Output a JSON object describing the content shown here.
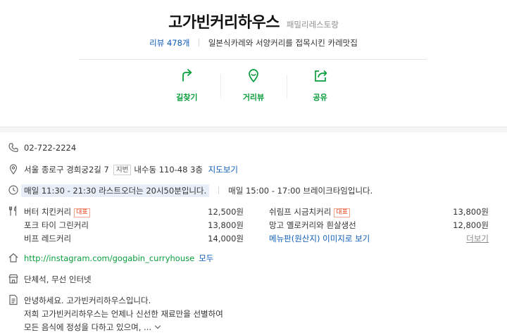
{
  "place": {
    "name": "고가빈커리하우스",
    "category": "패밀리레스토랑",
    "review_label": "리뷰 478개",
    "description": "일본식카레와 서양커리를 접목시킨 카레맛집"
  },
  "actions": [
    {
      "label": "길찾기",
      "icon": "directions-icon"
    },
    {
      "label": "거리뷰",
      "icon": "street-view-icon"
    },
    {
      "label": "공유",
      "icon": "share-icon"
    }
  ],
  "info": {
    "phone": "02-722-2224",
    "address": "서울 종로구 경희궁2길 7",
    "jibun_badge": "지번",
    "jibun_address": "내수동 110-48 3층",
    "map_link": "지도보기",
    "hours_1": "매일 11:30 - 21:30   라스트오더는 20시50분입니다.",
    "hours_2": "매일 15:00 - 17:00   브레이크타임입니다.",
    "menu": [
      {
        "name": "버터 치킨커리",
        "badge": "대표",
        "price": "12,500원"
      },
      {
        "name": "쉬림프 시금치커리",
        "badge": "대표",
        "price": "13,800원"
      },
      {
        "name": "포크 타이 그린커리",
        "badge": "",
        "price": "13,800원"
      },
      {
        "name": "망고 옐로커리와 흰살생선",
        "badge": "",
        "price": "12,800원"
      },
      {
        "name": "비프 레드커리",
        "badge": "",
        "price": "14,000원"
      }
    ],
    "menu_photo_link": "메뉴판(원산지) 이미지로 보기",
    "menu_more": "더보기",
    "homepage_url": "http://instagram.com/gogabin_curryhouse",
    "homepage_all": "모두",
    "amenities": "단체석, 무선 인터넷",
    "intro": [
      "안녕하세요. 고가빈커리하우스입니다.",
      "저희 고가빈커리하우스는 언제나 신선한 재료만을 선별하여",
      "모든 음식에 정성을 다하고 있으며, ..."
    ]
  },
  "colors": {
    "accent_green": "#0a9e3d",
    "link_blue": "#0e5db8",
    "badge_red": "#e7431c"
  }
}
